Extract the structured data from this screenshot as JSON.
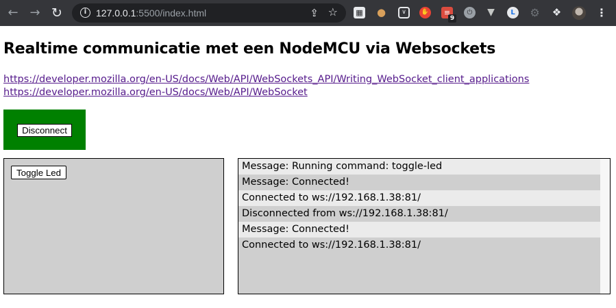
{
  "browser": {
    "url_host": "127.0.0.1",
    "url_rest": ":5500/index.html",
    "nav": {
      "back_icon": "arrow-left-icon",
      "forward_icon": "arrow-right-icon",
      "reload_icon": "reload-icon"
    },
    "extensions": [
      {
        "name": "qr-code-icon"
      },
      {
        "name": "cookie-icon"
      },
      {
        "name": "pocket-icon"
      },
      {
        "name": "stop-hand-icon"
      },
      {
        "name": "todoist-icon",
        "badge": "9"
      },
      {
        "name": "power-icon"
      },
      {
        "name": "vue-devtools-icon"
      },
      {
        "name": "lastpass-icon"
      },
      {
        "name": "gear-icon"
      },
      {
        "name": "puzzle-extensions-icon"
      }
    ]
  },
  "page": {
    "title": "Realtime communicatie met een NodeMCU via Websockets",
    "links": [
      "https://developer.mozilla.org/en-US/docs/Web/API/WebSockets_API/Writing_WebSocket_client_applications",
      "https://developer.mozilla.org/en-US/docs/Web/API/WebSocket"
    ],
    "connection_button": "Disconnect",
    "connection_box_color": "#008000",
    "toggle_button": "Toggle Led",
    "log": [
      "Message: Running command: toggle-led",
      "Message: Connected!",
      "Connected to ws://192.168.1.38:81/",
      "Disconnected from ws://192.168.1.38:81/",
      "Message: Connected!",
      "Connected to ws://192.168.1.38:81/"
    ]
  }
}
